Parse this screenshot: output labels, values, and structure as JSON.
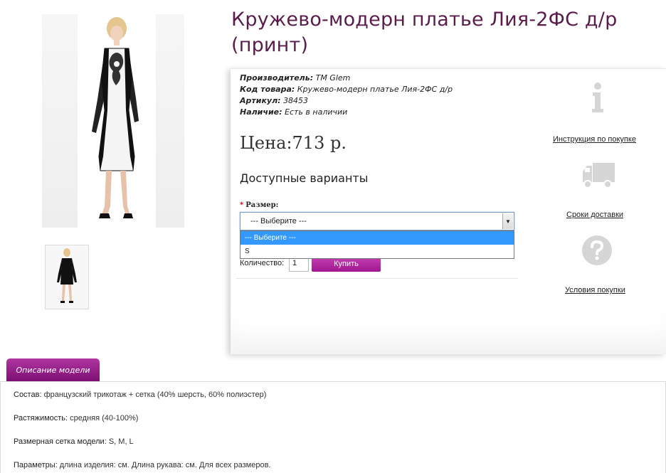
{
  "product": {
    "title": "Кружево-модерн платье Лия-2ФС д/р (принт)"
  },
  "meta": {
    "manufacturer_label": "Производитель:",
    "manufacturer_value": "ТМ Glem",
    "code_label": "Код товара:",
    "code_value": "Кружево-модерн платье Лия-2ФС д/р",
    "article_label": "Артикул:",
    "article_value": "38453",
    "availability_label": "Наличие:",
    "availability_value": "Есть в наличии"
  },
  "price": "Цена:713 р.",
  "variants": {
    "title": "Доступные варианты",
    "required_mark": "*",
    "size_label": "Размер:",
    "selected": "--- Выберите ---",
    "options": [
      "--- Выберите ---",
      "S"
    ]
  },
  "purchase": {
    "quantity_label": "Количество:",
    "quantity_value": "1",
    "buy_label": "Купить"
  },
  "sidebar": {
    "instruction_label": "Инструкция по покупке",
    "delivery_label": "Сроки доставки",
    "terms_label": "Условия покупки"
  },
  "description": {
    "tab_label": "Описание модели",
    "composition_label": "Состав:",
    "composition_value": "французский трикотаж + сетка (40% шерсть, 60% полиэстер)",
    "stretch_label": "Растяжимость:",
    "stretch_value": "средняя (40-100%)",
    "sizes_label": "Размерная сетка модели:",
    "sizes_value": "S, M, L",
    "params_label": "Параметры:",
    "params_value": "длина изделия: см. Длина рукава: см. Для всех размеров."
  },
  "colors": {
    "title": "#5a1d4b",
    "accent": "#a0178f",
    "select_highlight": "#3399ff"
  }
}
